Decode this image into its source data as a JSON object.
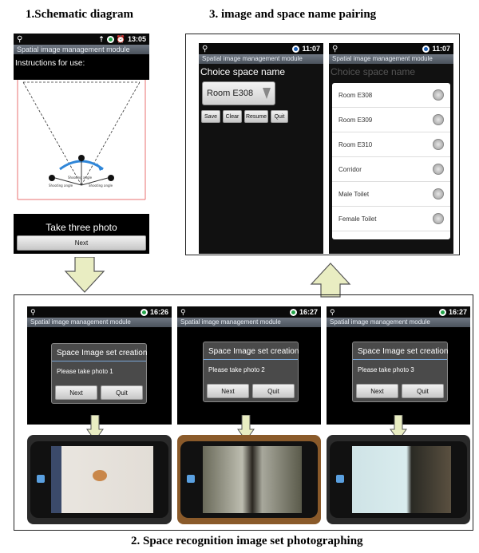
{
  "captions": {
    "c1": "1.Schematic diagram",
    "c3": "3. image and space name pairing",
    "c2": "2. Space recognition image set photographing"
  },
  "phone1": {
    "time": "13:05",
    "title": "Spatial image management module",
    "instructions": "Instructions for use:",
    "shooting_angle": "Shooting angle",
    "take_three": "Take three photo",
    "next": "Next"
  },
  "phone3a": {
    "time": "11:07",
    "title": "Spatial image management module",
    "choice_label": "Choice space name",
    "selected_room": "Room E308",
    "buttons": [
      "Save",
      "Clear",
      "Resume",
      "Quit"
    ]
  },
  "phone3b": {
    "time": "11:07",
    "title": "Spatial image management module",
    "choice_label": "Choice space name",
    "options": [
      "Room E308",
      "Room E309",
      "Room E310",
      "Corridor",
      "Male Toilet",
      "Female Toilet"
    ]
  },
  "capture_screens": [
    {
      "time": "16:26",
      "title": "Spatial image management module",
      "dialog_title": "Space Image set creation",
      "message": "Please take photo 1",
      "next": "Next",
      "quit": "Quit"
    },
    {
      "time": "16:27",
      "title": "Spatial image management module",
      "dialog_title": "Space Image set creation",
      "message": "Please take photo 2",
      "next": "Next",
      "quit": "Quit"
    },
    {
      "time": "16:27",
      "title": "Spatial image management module",
      "dialog_title": "Space Image set creation",
      "message": "Please take photo 3",
      "next": "Next",
      "quit": "Quit"
    }
  ],
  "colors": {
    "accent_blue": "#2f86d8",
    "status_green": "#24a64a",
    "arrow_fill": "#e9edc2"
  }
}
